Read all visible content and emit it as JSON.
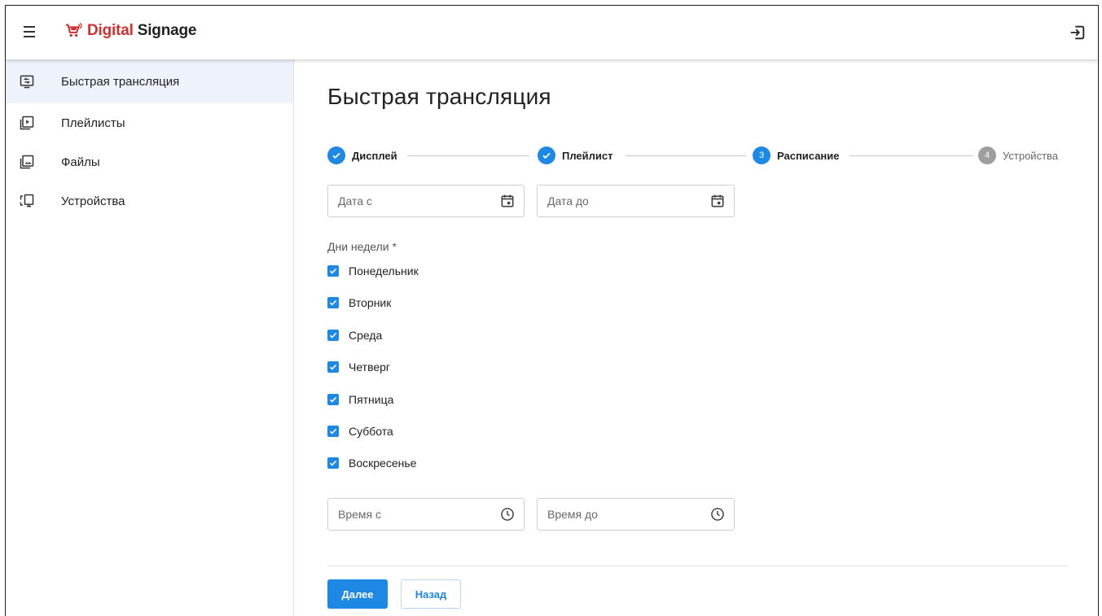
{
  "header": {
    "logo_accent": "Digital",
    "logo_rest": " Signage"
  },
  "sidebar": {
    "items": [
      {
        "label": "Быстрая трансляция",
        "icon": "screen-share-icon"
      },
      {
        "label": "Плейлисты",
        "icon": "playlist-icon"
      },
      {
        "label": "Файлы",
        "icon": "image-file-icon"
      },
      {
        "label": "Устройства",
        "icon": "devices-icon"
      }
    ]
  },
  "main": {
    "title": "Быстрая трансляция",
    "stepper": {
      "steps": [
        {
          "label": "Дисплей",
          "state": "done"
        },
        {
          "label": "Плейлист",
          "state": "done"
        },
        {
          "label": "Расписание",
          "state": "active",
          "number": "3"
        },
        {
          "label": "Устройства",
          "state": "pending",
          "number": "4"
        }
      ]
    },
    "date_from": {
      "placeholder": "Дата с"
    },
    "date_to": {
      "placeholder": "Дата до"
    },
    "days_label": "Дни недели *",
    "days": [
      {
        "label": "Понедельник",
        "checked": true
      },
      {
        "label": "Вторник",
        "checked": true
      },
      {
        "label": "Среда",
        "checked": true
      },
      {
        "label": "Четверг",
        "checked": true
      },
      {
        "label": "Пятница",
        "checked": true
      },
      {
        "label": "Суббота",
        "checked": true
      },
      {
        "label": "Воскресенье",
        "checked": true
      }
    ],
    "time_from": {
      "placeholder": "Время с"
    },
    "time_to": {
      "placeholder": "Время до"
    },
    "next_label": "Далее",
    "back_label": "Назад"
  },
  "colors": {
    "accent": "#1e88e5",
    "brand_red": "#d32f2f",
    "active_nav_bg": "#eef3fb"
  }
}
